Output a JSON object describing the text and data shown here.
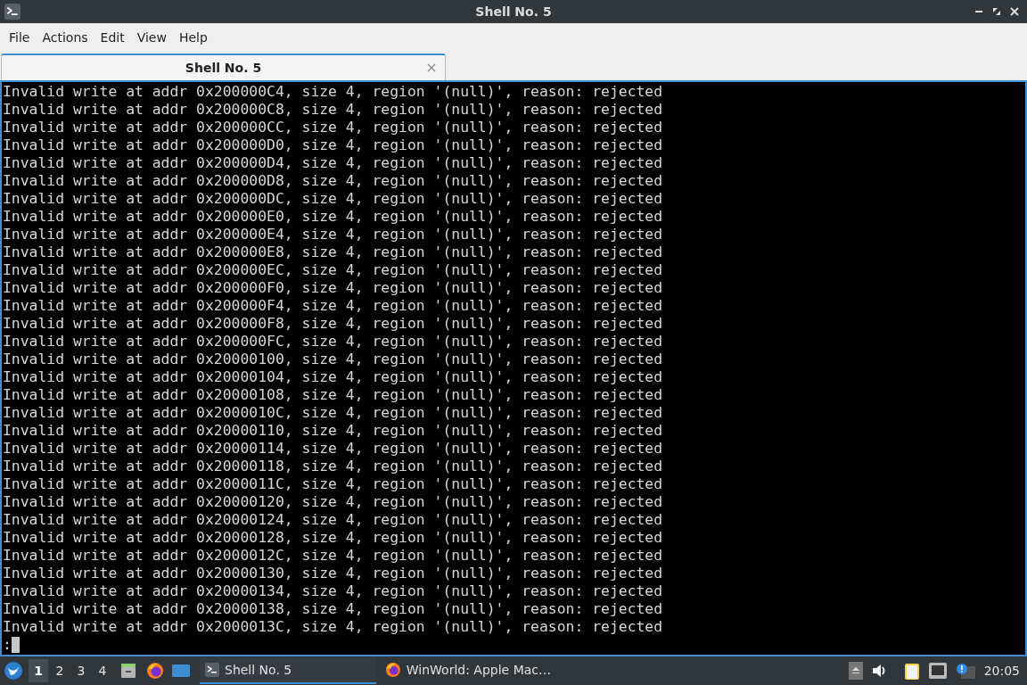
{
  "window": {
    "title": "Shell No. 5"
  },
  "menu": [
    "File",
    "Actions",
    "Edit",
    "View",
    "Help"
  ],
  "tabs": [
    {
      "label": "Shell No. 5",
      "selected": true
    }
  ],
  "terminal": {
    "lines": [
      "Invalid write at addr 0x200000C4, size 4, region '(null)', reason: rejected",
      "Invalid write at addr 0x200000C8, size 4, region '(null)', reason: rejected",
      "Invalid write at addr 0x200000CC, size 4, region '(null)', reason: rejected",
      "Invalid write at addr 0x200000D0, size 4, region '(null)', reason: rejected",
      "Invalid write at addr 0x200000D4, size 4, region '(null)', reason: rejected",
      "Invalid write at addr 0x200000D8, size 4, region '(null)', reason: rejected",
      "Invalid write at addr 0x200000DC, size 4, region '(null)', reason: rejected",
      "Invalid write at addr 0x200000E0, size 4, region '(null)', reason: rejected",
      "Invalid write at addr 0x200000E4, size 4, region '(null)', reason: rejected",
      "Invalid write at addr 0x200000E8, size 4, region '(null)', reason: rejected",
      "Invalid write at addr 0x200000EC, size 4, region '(null)', reason: rejected",
      "Invalid write at addr 0x200000F0, size 4, region '(null)', reason: rejected",
      "Invalid write at addr 0x200000F4, size 4, region '(null)', reason: rejected",
      "Invalid write at addr 0x200000F8, size 4, region '(null)', reason: rejected",
      "Invalid write at addr 0x200000FC, size 4, region '(null)', reason: rejected",
      "Invalid write at addr 0x20000100, size 4, region '(null)', reason: rejected",
      "Invalid write at addr 0x20000104, size 4, region '(null)', reason: rejected",
      "Invalid write at addr 0x20000108, size 4, region '(null)', reason: rejected",
      "Invalid write at addr 0x2000010C, size 4, region '(null)', reason: rejected",
      "Invalid write at addr 0x20000110, size 4, region '(null)', reason: rejected",
      "Invalid write at addr 0x20000114, size 4, region '(null)', reason: rejected",
      "Invalid write at addr 0x20000118, size 4, region '(null)', reason: rejected",
      "Invalid write at addr 0x2000011C, size 4, region '(null)', reason: rejected",
      "Invalid write at addr 0x20000120, size 4, region '(null)', reason: rejected",
      "Invalid write at addr 0x20000124, size 4, region '(null)', reason: rejected",
      "Invalid write at addr 0x20000128, size 4, region '(null)', reason: rejected",
      "Invalid write at addr 0x2000012C, size 4, region '(null)', reason: rejected",
      "Invalid write at addr 0x20000130, size 4, region '(null)', reason: rejected",
      "Invalid write at addr 0x20000134, size 4, region '(null)', reason: rejected",
      "Invalid write at addr 0x20000138, size 4, region '(null)', reason: rejected",
      "Invalid write at addr 0x2000013C, size 4, region '(null)', reason: rejected"
    ],
    "prompt": ":"
  },
  "taskbar": {
    "workspaces": [
      {
        "label": "1",
        "selected": true
      },
      {
        "label": "2",
        "selected": false
      },
      {
        "label": "3",
        "selected": false
      },
      {
        "label": "4",
        "selected": false
      }
    ],
    "tasks": [
      {
        "label": "Shell No. 5",
        "kind": "terminal",
        "selected": true
      },
      {
        "label": "WinWorld: Apple Mac…",
        "kind": "browser",
        "selected": false
      }
    ],
    "clock": "20:05"
  }
}
